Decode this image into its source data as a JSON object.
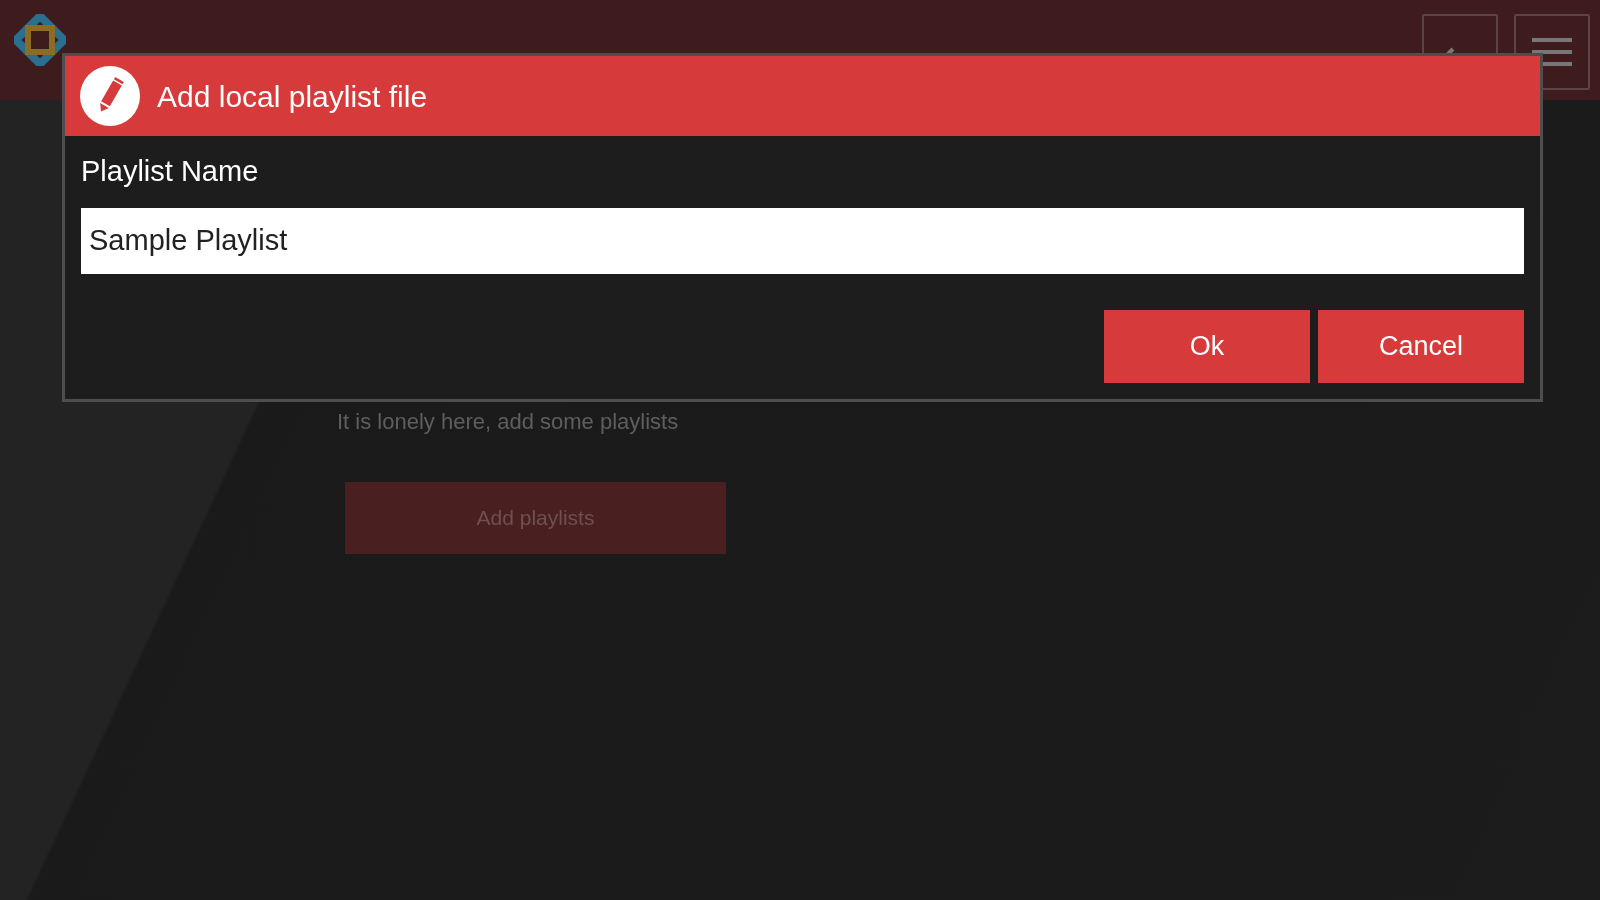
{
  "empty_state": {
    "message": "It is lonely here, add some playlists",
    "button": "Add playlists"
  },
  "dialog": {
    "title": "Add local playlist file",
    "field_label": "Playlist Name",
    "field_value": "Sample Playlist",
    "buttons": [
      "Ok",
      "Cancel"
    ]
  }
}
